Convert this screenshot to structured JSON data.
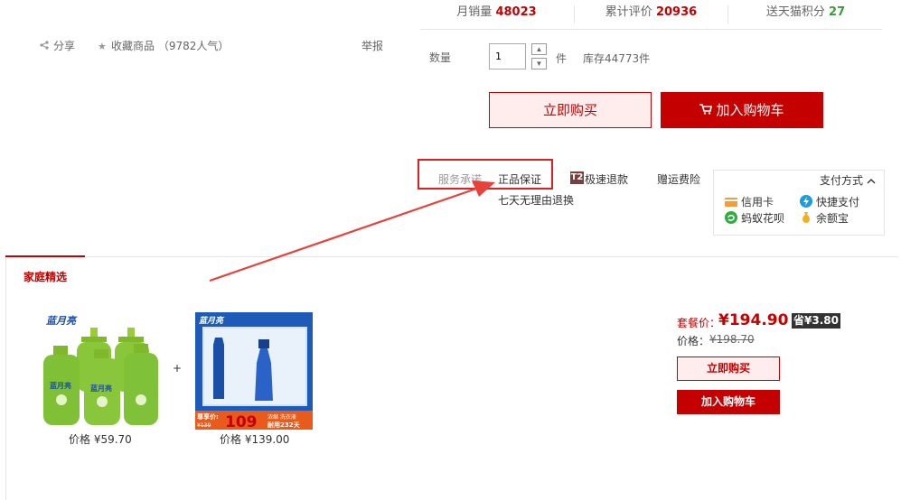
{
  "stats": {
    "monthly_sales_label": "月销量",
    "monthly_sales_value": "48023",
    "reviews_label": "累计评价",
    "reviews_value": "20936",
    "points_label": "送天猫积分",
    "points_value": "27"
  },
  "actions": {
    "share": "分享",
    "favorite": "收藏商品",
    "favorite_count": "（9782人气）",
    "report": "举报"
  },
  "quantity": {
    "label": "数量",
    "value": "1",
    "unit": "件",
    "stock": "库存44773件"
  },
  "buttons": {
    "buy_now": "立即购买",
    "add_cart": "加入购物车"
  },
  "service": {
    "label": "服务承诺",
    "authentic": "正品保证",
    "t2_badge": "T2",
    "t2_label": "极速退款",
    "freight": "赠运费险",
    "seven_day": "七天无理由退换"
  },
  "payment": {
    "title": "支付方式",
    "methods": [
      "信用卡",
      "快捷支付",
      "蚂蚁花呗",
      "余额宝"
    ]
  },
  "section": {
    "title": "家庭精选"
  },
  "combo": {
    "product1_price": "价格 ¥59.70",
    "product2_price": "价格 ¥139.00",
    "plus": "+",
    "combo_label": "套餐价：",
    "combo_price": "¥194.90",
    "save": "省¥3.80",
    "orig_label": "价格：",
    "orig_price": "¥198.70",
    "buy_now": "立即购买",
    "add_cart": "加入购物车",
    "p2_banner_label": "尊享价:",
    "p2_banner_old": "¥139",
    "p2_banner_price": "109",
    "p2_banner_note1": "浓缩 洗衣液",
    "p2_banner_note2": "耐用232天",
    "brand": "蓝月亮"
  },
  "colors": {
    "accent": "#c40000",
    "highlight": "#e02020"
  }
}
